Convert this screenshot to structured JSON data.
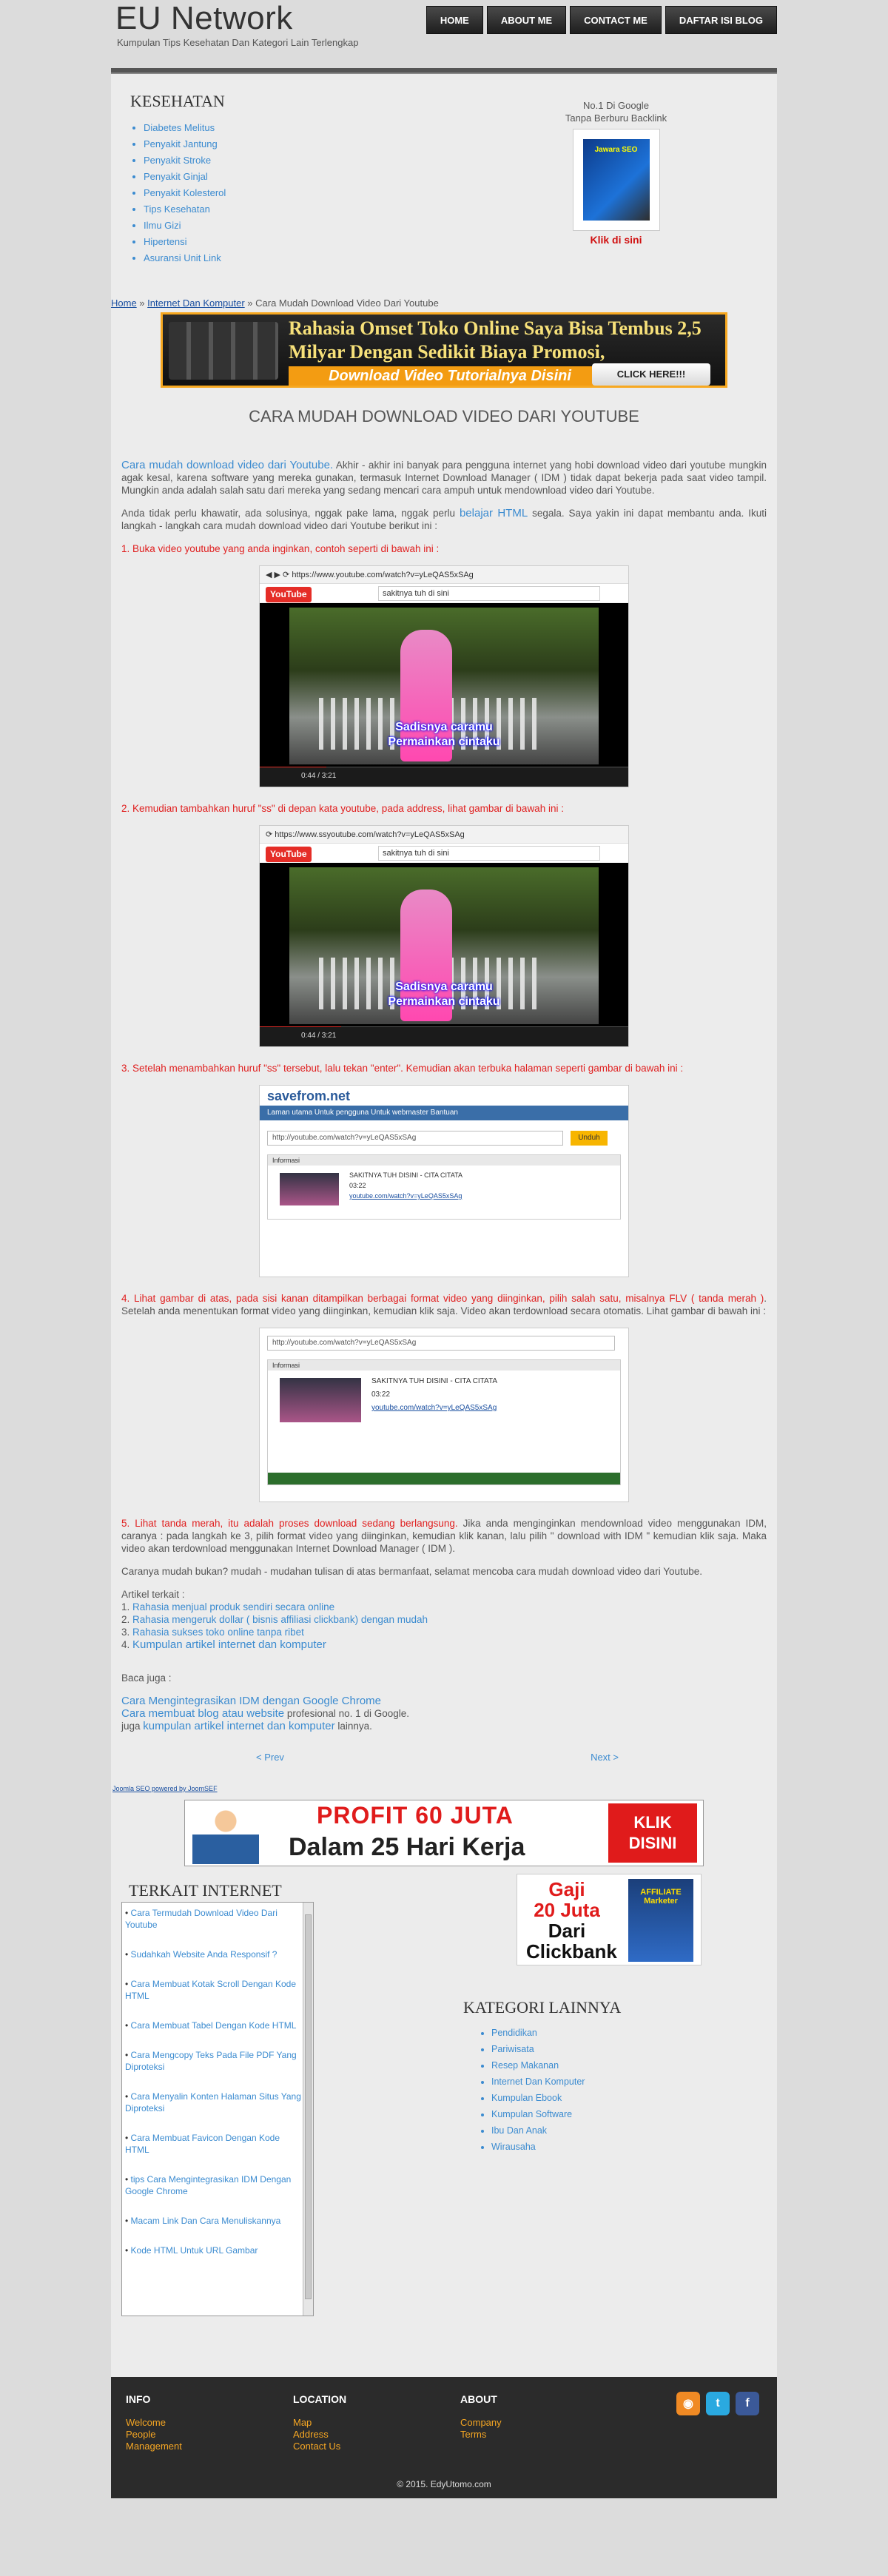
{
  "header": {
    "site_title": "EU Network",
    "subtitle": "Kumpulan Tips Kesehatan Dan Kategori Lain Terlengkap",
    "nav": [
      "HOME",
      "ABOUT ME",
      "CONTACT ME",
      "DAFTAR ISI BLOG"
    ]
  },
  "kesehatan": {
    "title": "KESEHATAN",
    "items": [
      "Diabetes Melitus",
      "Penyakit Jantung",
      "Penyakit Stroke",
      "Penyakit Ginjal",
      "Penyakit Kolesterol",
      "Tips Kesehatan",
      "Ilmu Gizi",
      "Hipertensi",
      "Asuransi Unit Link"
    ]
  },
  "promo": {
    "line1": "No.1 Di Google",
    "line2": "Tanpa Berburu Backlink",
    "book_text": "Jawara SEO",
    "cta": "Klik di sini"
  },
  "breadcrumb": {
    "home": "Home",
    "sep": " » ",
    "category": "Internet Dan Komputer",
    "current": " » Cara Mudah Download Video Dari Youtube"
  },
  "banner1": {
    "line1": "Rahasia Omset Toko Online Saya Bisa Tembus 2,5",
    "line2": "Milyar Dengan Sedikit Biaya Promosi,",
    "line3": "Download Video Tutorialnya Disini",
    "cta": "CLICK HERE!!!"
  },
  "article": {
    "title": "CARA MUDAH DOWNLOAD VIDEO DARI YOUTUBE",
    "intro_link": "Cara mudah download video dari Youtube.",
    "intro_text": " Akhir - akhir ini banyak para pengguna internet yang hobi download video dari youtube mungkin agak kesal, karena software yang mereka gunakan, termasuk Internet Download Manager ( IDM ) tidak dapat bekerja pada saat video tampil. Mungkin anda adalah salah satu dari mereka yang sedang mencari cara ampuh untuk mendownload video dari Youtube.",
    "p2_a": "Anda tidak perlu khawatir, ada solusinya, nggak pake lama, nggak perlu ",
    "p2_link": "belajar HTML",
    "p2_b": " segala. Saya yakin ini dapat membantu anda. Ikuti langkah - langkah cara mudah download video dari Youtube berikut ini :",
    "step1": "1. Buka video youtube yang anda inginkan, contoh seperti di bawah ini :",
    "step2": "2. Kemudian tambahkan huruf \"ss\" di depan kata youtube, pada address, lihat gambar di bawah ini :",
    "step3": "3. Setelah menambahkan huruf \"ss\" tersebut, lalu tekan \"enter\". Kemudian akan terbuka halaman seperti gambar di bawah ini :",
    "step4_red": "4. Lihat gambar di atas, pada sisi kanan ditampilkan berbagai format video yang diinginkan, pilih salah satu, misalnya FLV ( tanda merah )",
    "step4_text": ". Setelah anda menentukan format video yang diinginkan, kemudian klik saja. Video akan terdownload secara otomatis. Lihat gambar di bawah ini :",
    "step5_red": "5. Lihat tanda merah, itu adalah proses download sedang berlangsung.",
    "step5_text": " Jika anda menginginkan mendownload video menggunakan IDM, caranya : pada langkah ke 3, pilih format video yang diinginkan, kemudian klik kanan, lalu pilih \" download with IDM \" kemudian klik saja. Maka video akan terdownload menggunakan Internet Download Manager ( IDM ).",
    "closing": "Caranya mudah bukan? mudah - mudahan tulisan di atas bermanfaat, selamat mencoba cara mudah download video dari Youtube.",
    "artikel_label": "Artikel terkait :",
    "related": [
      {
        "num": "1. ",
        "text": "Rahasia menjual produk sendiri secara online"
      },
      {
        "num": "2. ",
        "text": "Rahasia mengeruk dollar ( bisnis affiliasi clickbank) dengan mudah"
      },
      {
        "num": "3. ",
        "text": "Rahasia sukses toko online tanpa ribet"
      },
      {
        "num": "4. ",
        "text": "Kumpulan artikel internet dan komputer"
      }
    ],
    "baca_juga": "Baca juga :",
    "baca1": "Cara Mengintegrasikan IDM dengan Google Chrome",
    "baca2_link": "Cara membuat blog atau website",
    "baca2_text": " profesional no. 1 di Google.",
    "baca3_pre": "juga ",
    "baca3_link": "kumpulan artikel internet dan komputer",
    "baca3_post": " lainnya."
  },
  "shots": {
    "url1": "https://www.youtube.com/watch?v=yLeQAS5xSAg",
    "url2": "https://www.ssyoutube.com/watch?v=yLeQAS5xSAg",
    "search1": "sakitnya tuh di sini",
    "search2": "sakitnya tuh di sini",
    "yt_logo": "YouTube",
    "subtitle_line1": "Sadisnya caramu",
    "subtitle_line2": "Permainkan cintaku",
    "time1": "0:44 / 3:21",
    "time2": "0:44 / 3:21",
    "sf_logo": "savefrom.net",
    "sf_nav": "Laman utama    Untuk pengguna    Untuk webmaster    Bantuan",
    "sf_input": "http://youtube.com/watch?v=yLeQAS5xSAg",
    "sf_btn": "Unduh",
    "sf_info": "Informasi",
    "sf_title": "SAKITNYA TUH DISINI - CITA CITATA",
    "sf_duration": "03:22",
    "sf_link": "youtube.com/watch?v=yLeQAS5xSAg"
  },
  "pager": {
    "prev": "< Prev",
    "next": "Next >"
  },
  "powered": "Joomla SEO powered by JoomSEF",
  "banner2": {
    "t1": "PROFIT 60 JUTA",
    "t2": "Dalam 25 Hari Kerja",
    "cta": "KLIK DISINI"
  },
  "terkait": {
    "title": "TERKAIT INTERNET",
    "items": [
      "Cara Termudah Download Video Dari Youtube",
      "Sudahkah Website Anda Responsif ?",
      "Cara Membuat Kotak Scroll Dengan Kode HTML",
      "Cara Membuat Tabel Dengan Kode HTML",
      "Cara Mengcopy Teks Pada File PDF Yang Diproteksi",
      "Cara Menyalin Konten Halaman Situs Yang Diproteksi",
      "Cara Membuat Favicon Dengan Kode HTML",
      "tips Cara Mengintegrasikan IDM Dengan Google Chrome",
      "Macam Link Dan Cara Menuliskannya",
      "Kode HTML Untuk URL Gambar"
    ]
  },
  "gaji": {
    "line1": "Gaji\n20 Juta",
    "line2": "Dari\nClickbank",
    "book": "AFFILIATE Marketer"
  },
  "kategori": {
    "title": "KATEGORI LAINNYA",
    "items": [
      "Pendidikan",
      "Pariwisata",
      "Resep Makanan",
      "Internet Dan Komputer",
      "Kumpulan Ebook",
      "Kumpulan Software",
      "Ibu Dan Anak",
      "Wirausaha"
    ]
  },
  "footer": {
    "info_title": "INFO",
    "info_links": [
      "Welcome",
      "People",
      "Management"
    ],
    "location_title": "LOCATION",
    "location_links": [
      "Map",
      "Address",
      "Contact Us"
    ],
    "about_title": "ABOUT",
    "about_links": [
      "Company",
      "Terms"
    ],
    "copyright": "© 2015. EdyUtomo.com"
  },
  "colors": {
    "accent": "#3b8bd0",
    "red": "#e02020",
    "footer_bg": "#2b2b2b",
    "footer_link": "#f5a623"
  }
}
